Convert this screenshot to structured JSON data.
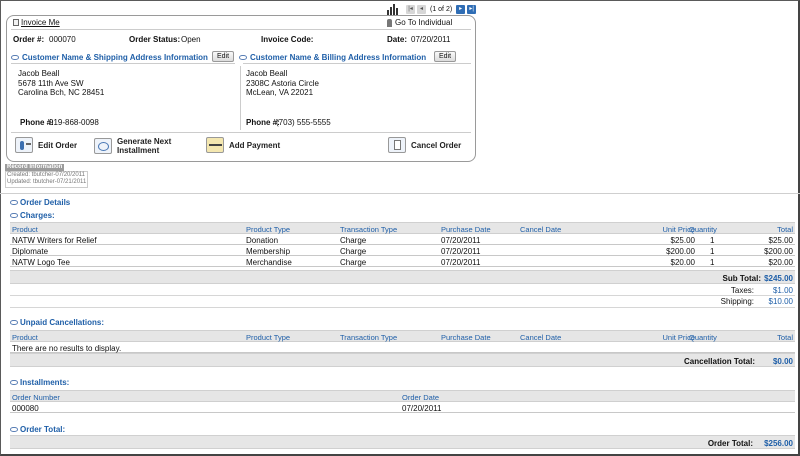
{
  "pager": {
    "info": "(1 of 2)",
    "first": "|◂",
    "prev": "◂",
    "next": "▸",
    "last": "▸|"
  },
  "header": {
    "invoice_link": "Invoice Me",
    "goto_label": "Go To Individual",
    "order_no_label": "Order #:",
    "order_no": "000070",
    "status_label": "Order Status:",
    "status": "Open",
    "invoice_code_label": "Invoice Code:",
    "invoice_code": "",
    "date_label": "Date:",
    "date": "07/20/2011"
  },
  "shipping": {
    "title": "Customer Name & Shipping Address Information",
    "edit": "Edit",
    "name": "Jacob Beall",
    "line1": "5678 11th Ave SW",
    "line2": "Carolina Bch, NC 28451",
    "phone_label": "Phone #:",
    "phone": "919-868-0098"
  },
  "billing": {
    "title": "Customer Name & Billing Address Information",
    "edit": "Edit",
    "name": "Jacob Beall",
    "line1": "2308C Astoria Circle",
    "line2": "McLean, VA 22021",
    "phone_label": "Phone #:",
    "phone": "(703) 555-5555"
  },
  "actions": {
    "edit_order": "Edit Order",
    "generate_line1": "Generate Next",
    "generate_line2": "Installment",
    "add_payment": "Add Payment",
    "cancel_order": "Cancel Order"
  },
  "record": {
    "title": "Record Information",
    "created": "Created: tbutcher-07/20/2011",
    "updated": "Updated: tbutcher-07/21/2011"
  },
  "order_details": "Order Details",
  "charges": {
    "title": "Charges:",
    "columns": [
      "Product",
      "Product Type",
      "Transaction Type",
      "Purchase Date",
      "Cancel Date",
      "Unit Price",
      "Quantity",
      "Total"
    ],
    "rows": [
      [
        "NATW Writers for Relief",
        "Donation",
        "Charge",
        "07/20/2011",
        "",
        "$25.00",
        "1",
        "$25.00"
      ],
      [
        "Diplomate",
        "Membership",
        "Charge",
        "07/20/2011",
        "",
        "$200.00",
        "1",
        "$200.00"
      ],
      [
        "NATW Logo Tee",
        "Merchandise",
        "Charge",
        "07/20/2011",
        "",
        "$20.00",
        "1",
        "$20.00"
      ]
    ],
    "subtotal_label": "Sub Total:",
    "subtotal": "$245.00",
    "taxes_label": "Taxes:",
    "taxes": "$1.00",
    "shipping_label": "Shipping:",
    "shipping": "$10.00"
  },
  "unpaid": {
    "title": "Unpaid Cancellations:",
    "columns": [
      "Product",
      "Product Type",
      "Transaction Type",
      "Purchase Date",
      "Cancel Date",
      "Unit Price",
      "Quantity",
      "Total"
    ],
    "empty": "There are no results to display.",
    "total_label": "Cancellation Total:",
    "total": "$0.00"
  },
  "installments": {
    "title": "Installments:",
    "columns": [
      "Order Number",
      "Order Date"
    ],
    "rows": [
      [
        "000080",
        "07/20/2011"
      ]
    ]
  },
  "order_total": {
    "title": "Order Total:",
    "label": "Order Total:",
    "value": "$256.00"
  },
  "colors": {
    "link_blue": "#1f5fa8",
    "header_gray": "#e6e6e6"
  }
}
